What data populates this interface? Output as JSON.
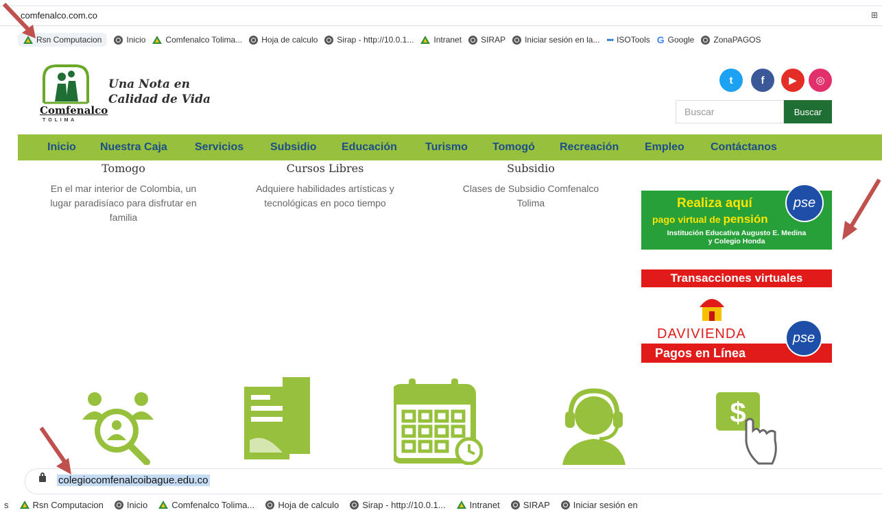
{
  "browser_top": {
    "url": "comfenalco.com.co",
    "bookmarks": [
      {
        "label": "Rsn Computacion",
        "icon": "drive-icon"
      },
      {
        "label": "Inicio",
        "icon": "globe-icon"
      },
      {
        "label": "Comfenalco Tolima...",
        "icon": "drive-icon"
      },
      {
        "label": "Hoja de calculo",
        "icon": "globe-icon"
      },
      {
        "label": "Sirap - http://10.0.1...",
        "icon": "globe-icon"
      },
      {
        "label": "Intranet",
        "icon": "drive-icon"
      },
      {
        "label": "SIRAP",
        "icon": "globe-icon"
      },
      {
        "label": "Iniciar sesión en la...",
        "icon": "globe-icon"
      },
      {
        "label": "ISOTools",
        "icon": "dots-icon"
      },
      {
        "label": "Google",
        "icon": "google-icon"
      },
      {
        "label": "ZonaPAGOS",
        "icon": "globe-icon"
      }
    ]
  },
  "header": {
    "logo_name": "Comfenalco",
    "logo_sub": "T O L I M A",
    "slogan_line1": "Una Nota en",
    "slogan_line2": "Calidad de Vida",
    "social": [
      {
        "name": "twitter-icon",
        "glyph": "t",
        "color": "#1da1f2"
      },
      {
        "name": "facebook-icon",
        "glyph": "f",
        "color": "#3b5998"
      },
      {
        "name": "youtube-icon",
        "glyph": "▶",
        "color": "#e52d27"
      },
      {
        "name": "instagram-icon",
        "glyph": "◎",
        "color": "#e1306c"
      }
    ],
    "search_placeholder": "Buscar",
    "search_button": "Buscar"
  },
  "nav": [
    "Inicio",
    "Nuestra Caja",
    "Servicios",
    "Subsidio",
    "Educación",
    "Turismo",
    "Tomogó",
    "Recreación",
    "Empleo",
    "Contáctanos"
  ],
  "cards": [
    {
      "title": "Tomogo",
      "text": [
        "En el mar interior de Colombia, un",
        "lugar paradisíaco para disfrutar en",
        "familia"
      ]
    },
    {
      "title": "Cursos Libres",
      "text": [
        "Adquiere habilidades artísticas y",
        "tecnológicas en poco tiempo"
      ]
    },
    {
      "title": "Subsidio",
      "text": [
        "Clases de Subsidio Comfenalco",
        "Tolima"
      ]
    }
  ],
  "pse_banner": {
    "line1": "Realiza aquí",
    "line2_prefix": "pago virtual de ",
    "line2_strong": "pensión",
    "line3": "Institución Educativa Augusto E. Medina",
    "line4": "y Colegio Honda",
    "badge": "pse"
  },
  "davivienda": {
    "header": "Transacciones virtuales",
    "brand": "DAVIVIENDA",
    "footer": "Pagos en Línea",
    "badge": "pse"
  },
  "browser_bottom": {
    "url": "colegiocomfenalcoibague.edu.co",
    "bookmarks": [
      {
        "label": "s",
        "icon": ""
      },
      {
        "label": "Rsn Computacion",
        "icon": "drive-icon"
      },
      {
        "label": "Inicio",
        "icon": "globe-icon"
      },
      {
        "label": "Comfenalco Tolima...",
        "icon": "drive-icon"
      },
      {
        "label": "Hoja de calculo",
        "icon": "globe-icon"
      },
      {
        "label": "Sirap - http://10.0.1...",
        "icon": "globe-icon"
      },
      {
        "label": "Intranet",
        "icon": "drive-icon"
      },
      {
        "label": "SIRAP",
        "icon": "globe-icon"
      },
      {
        "label": "Iniciar sesión en",
        "icon": "globe-icon"
      }
    ]
  },
  "colors": {
    "nav_green": "#97c13c",
    "nav_text": "#1d4e8a",
    "icon_green": "#97c13c",
    "arrow_red": "#c0504d"
  }
}
